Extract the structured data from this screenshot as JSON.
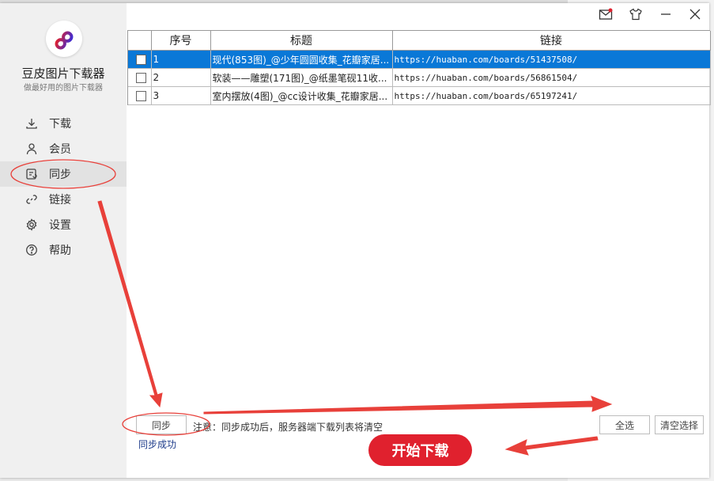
{
  "app": {
    "title": "豆皮图片下载器",
    "subtitle": "做最好用的图片下载器"
  },
  "sidebar": {
    "items": [
      {
        "label": "下载",
        "icon": "download-icon"
      },
      {
        "label": "会员",
        "icon": "user-icon"
      },
      {
        "label": "同步",
        "icon": "sync-icon",
        "active": true
      },
      {
        "label": "链接",
        "icon": "link-icon"
      },
      {
        "label": "设置",
        "icon": "gear-icon"
      },
      {
        "label": "帮助",
        "icon": "help-icon"
      }
    ]
  },
  "table": {
    "headers": [
      "序号",
      "标题",
      "链接"
    ],
    "rows": [
      {
        "no": "1",
        "title": "现代(853图)_@少年圆圆收集_花瓣家居...",
        "link": "https://huaban.com/boards/51437508/",
        "selected": true
      },
      {
        "no": "2",
        "title": "软装——雕塑(171图)_@纸墨笔砚11收...",
        "link": "https://huaban.com/boards/56861504/",
        "selected": false
      },
      {
        "no": "3",
        "title": "室内摆放(4图)_@cc设计收集_花瓣家居...",
        "link": "https://huaban.com/boards/65197241/",
        "selected": false
      }
    ]
  },
  "footer": {
    "sync_button": "同步",
    "note": "注意：同步成功后，服务器端下载列表将清空",
    "status": "同步成功",
    "select_all": "全选",
    "clear_selection": "清空选择",
    "start_download": "开始下载"
  },
  "colors": {
    "accent": "#e0212e",
    "selection": "#0a78d7",
    "annotation": "#e8403a"
  }
}
